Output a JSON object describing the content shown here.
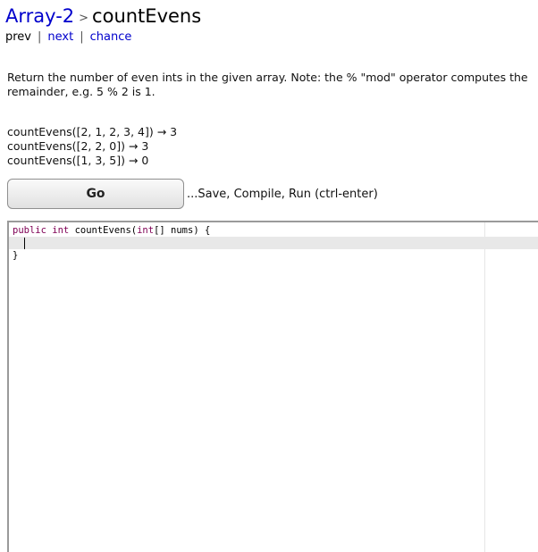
{
  "breadcrumb": {
    "section": "Array-2",
    "separator": ">",
    "title": "countEvens"
  },
  "nav": {
    "prev": "prev",
    "next": "next",
    "chance": "chance",
    "separator": "|"
  },
  "description": "Return the number of even ints in the given array. Note: the % \"mod\" operator computes the remainder, e.g. 5 % 2 is 1.",
  "examples": [
    "countEvens([2, 1, 2, 3, 4]) → 3",
    "countEvens([2, 2, 0]) → 3",
    "countEvens([1, 3, 5]) → 0"
  ],
  "go_button": {
    "label": "Go",
    "hint": "...Save, Compile, Run (ctrl-enter)"
  },
  "editor": {
    "kw_public": "public",
    "kw_int": "int",
    "method_name": "countEvens(",
    "kw_param_type": "int",
    "param_rest": "[] nums) {",
    "closing": "}"
  },
  "colors": {
    "link": "#0000cc",
    "keyword": "#7f0055",
    "active_line": "#e8e8e8"
  }
}
